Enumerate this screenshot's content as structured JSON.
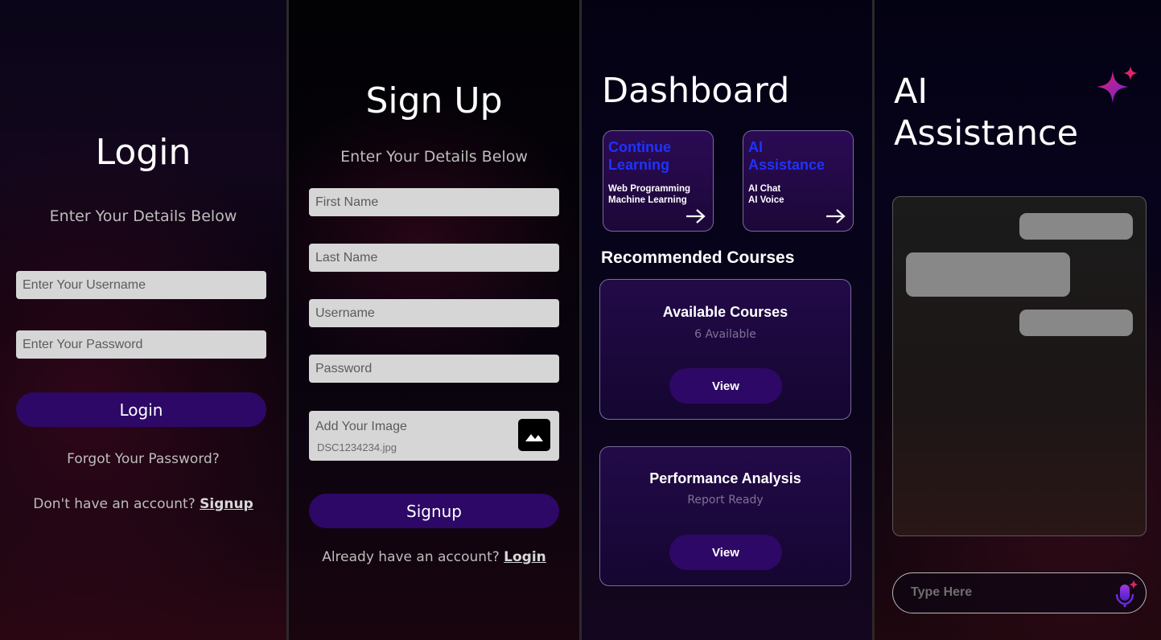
{
  "login": {
    "title": "Login",
    "subtitle": "Enter Your Details Below",
    "username_placeholder": "Enter Your Username",
    "password_placeholder": "Enter Your Password",
    "login_button": "Login",
    "forgot_password": "Forgot Your Password?",
    "no_account_text": "Don't have an account?",
    "signup_link": "Signup"
  },
  "signup": {
    "title": "Sign Up",
    "subtitle": "Enter Your Details Below",
    "first_name_placeholder": "First Name",
    "last_name_placeholder": "Last Name",
    "username_placeholder": "Username",
    "password_placeholder": "Password",
    "image_label": "Add Your Image",
    "image_file": "DSC1234234.jpg",
    "image_icon": "image-icon",
    "signup_button": "Signup",
    "have_account_text": "Already have an account?",
    "login_link": "Login"
  },
  "dashboard": {
    "title": "Dashboard",
    "cards": [
      {
        "title": "Continue Learning",
        "items": [
          "Web Programming",
          "Machine Learning"
        ],
        "icon": "arrow-right-icon"
      },
      {
        "title": "AI Assistance",
        "items": [
          "AI Chat",
          "AI Voice"
        ],
        "icon": "arrow-right-icon"
      }
    ],
    "recommended_heading": "Recommended Courses",
    "courses": [
      {
        "title": "Available Courses",
        "subtitle": "6 Available",
        "button": "View"
      },
      {
        "title": "Performance Analysis",
        "subtitle": "Report Ready",
        "button": "View"
      }
    ],
    "accent_color": "#1e33ff"
  },
  "ai": {
    "title_line1": "AI",
    "title_line2": "Assistance",
    "sparkle_icon": "sparkle-icon",
    "input_placeholder": "Type Here",
    "mic_icon": "ai-mic-icon"
  },
  "colors": {
    "primary_button": "#2d0867",
    "input_bg": "#d6d6d6"
  }
}
